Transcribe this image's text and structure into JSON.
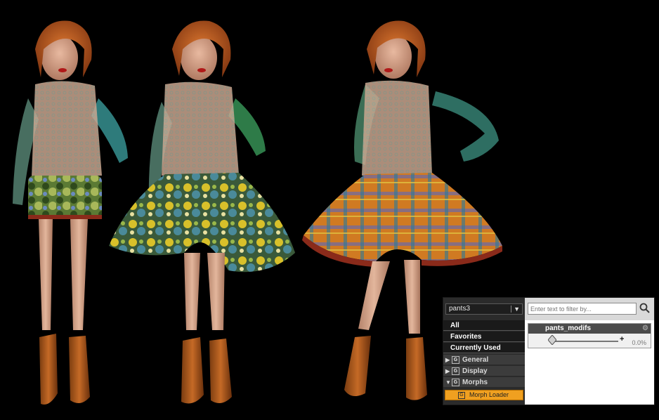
{
  "panel": {
    "node_select": "pants3",
    "categories": [
      "All",
      "Favorites",
      "Currently Used"
    ],
    "groups": [
      {
        "label": "General",
        "expanded": false
      },
      {
        "label": "Display",
        "expanded": false
      },
      {
        "label": "Morphs",
        "expanded": true
      }
    ],
    "group_icon": "G",
    "selected_item": "Morph Loader",
    "filter_placeholder": "Enter text to filter by...",
    "parameter": {
      "name": "pants_modifs",
      "value": "0.0%"
    },
    "colors": {
      "selection": "#f0a020",
      "panel_dark": "#2b2b2b",
      "panel_light": "#ffffff"
    }
  },
  "viewport": {
    "figures": [
      {
        "outfit": "green camouflage shorts"
      },
      {
        "outfit": "yellow-green patterned flared shorts"
      },
      {
        "outfit": "orange plaid flared shorts"
      }
    ]
  }
}
